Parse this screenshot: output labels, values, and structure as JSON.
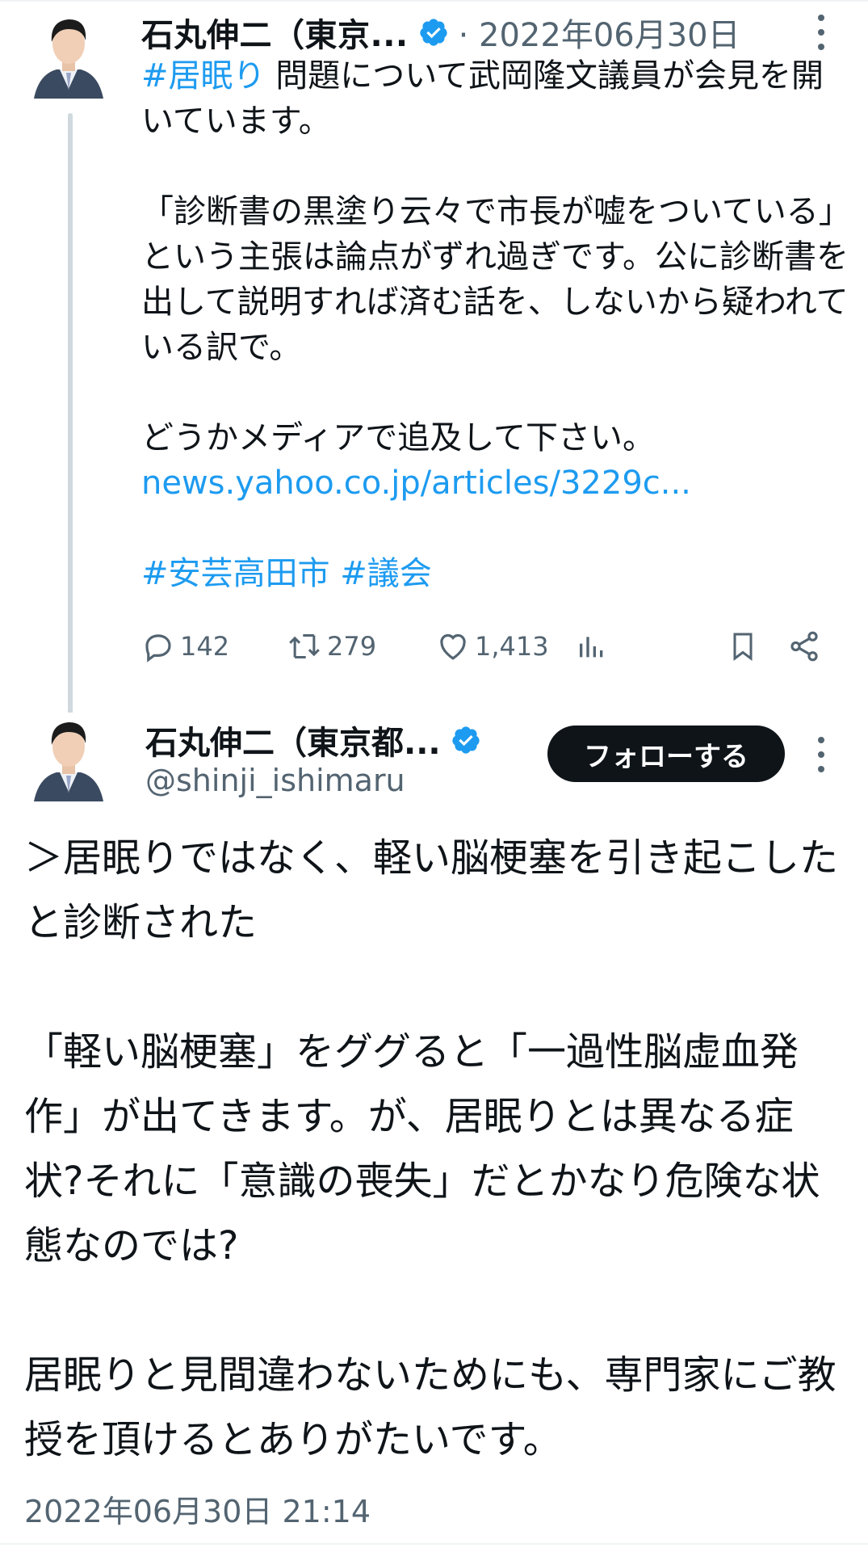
{
  "tweet1": {
    "author_name": "石丸伸二（東京...",
    "meta": "· 2022年06月30日",
    "hashtag_lead": "#居眠り",
    "text_1": " 問題について武岡隆文議員が会見を開いています。\n\n「診断書の黒塗り云々で市長が嘘をついている」という主張は論点がずれ過ぎです。公に診断書を出して説明すれば済む話を、しないから疑われている訳で。\n\nどうかメディアで追及して下さい。\n",
    "link": "news.yahoo.co.jp/articles/3229c...",
    "hashtag_2": "#安芸高田市",
    "hashtag_3": "#議会",
    "stats": {
      "replies": "142",
      "retweets": "279",
      "likes": "1,413"
    }
  },
  "tweet2": {
    "author_name": "石丸伸二（東京都...",
    "handle": "@shinji_ishimaru",
    "follow_label": "フォローする",
    "body": "＞居眠りではなく、軽い脳梗塞を引き起こしたと診断された\n\n「軽い脳梗塞」をググると「一過性脳虚血発作」が出てきます。が、居眠りとは異なる症状?それに「意識の喪失」だとかなり危険な状態なのでは?\n\n居眠りと見間違わないためにも、専門家にご教授を頂けるとありがたいです。",
    "timestamp": "2022年06月30日 21:14"
  },
  "colors": {
    "link": "#1d9bf0",
    "secondary_text": "#536471",
    "follow_button_bg": "#0f1419",
    "verified_badge": "#1d9bf0"
  },
  "icons": [
    "avatar",
    "verified-badge-icon",
    "more-icon",
    "reply-icon",
    "retweet-icon",
    "like-icon",
    "views-icon",
    "bookmark-icon",
    "share-icon"
  ]
}
